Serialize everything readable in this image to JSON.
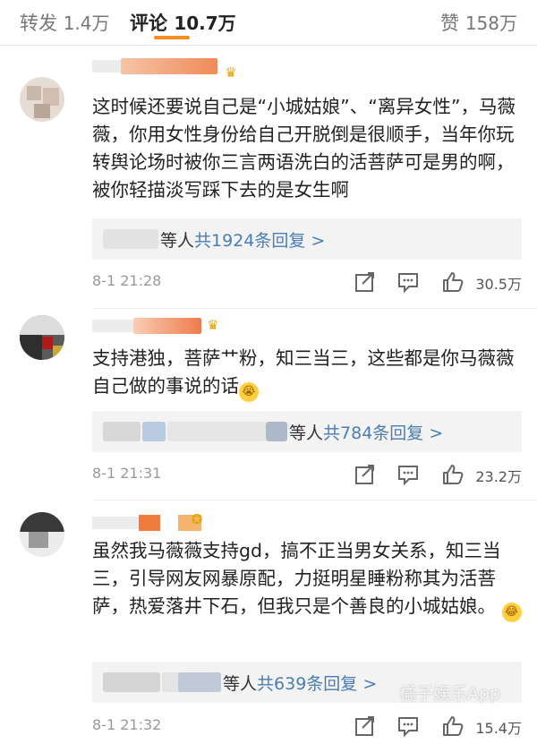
{
  "tabs": {
    "forward": {
      "label": "转发",
      "count": "1.4万"
    },
    "comments": {
      "label": "评论",
      "count": "10.7万"
    },
    "likes": {
      "label": "赞",
      "count": "158万"
    }
  },
  "accent_color": "#f78c1f",
  "link_color": "#4a7db4",
  "comments": [
    {
      "text": "这时候还要说自己是“小城姑娘”、“离异女性”，马薇薇，你用女性身份给自己开脱倒是很顺手，当年你玩转舆论场时被你三言两语洗白的活菩萨可是男的啊，被你轻描淡写踩下去的是女生啊",
      "reply_suffix": "等人",
      "reply_link": "共1924条回复 >",
      "time": "8-1 21:28",
      "likes": "30.5万",
      "badge": "crown-icon"
    },
    {
      "text": "支持港独，菩萨艹粉，知三当三，这些都是你马薇薇自己做的事说的话",
      "emoji": "😭",
      "reply_suffix": "等人",
      "reply_link": "共784条回复 >",
      "time": "8-1 21:31",
      "likes": "23.2万",
      "badge": "crown-icon"
    },
    {
      "text": "虽然我马薇薇支持gd，搞不正当男女关系，知三当三，引导网友网暴原配，力挺明星睡粉称其为活菩萨，热爱落井下石，但我只是个善良的小城姑娘。",
      "emoji": "😂",
      "reply_suffix": "等人",
      "reply_link": "共639条回复 >",
      "time": "8-1 21:32",
      "likes": "15.4万",
      "badge": "medal-icon"
    }
  ],
  "watermark": "橘子娱乐App"
}
